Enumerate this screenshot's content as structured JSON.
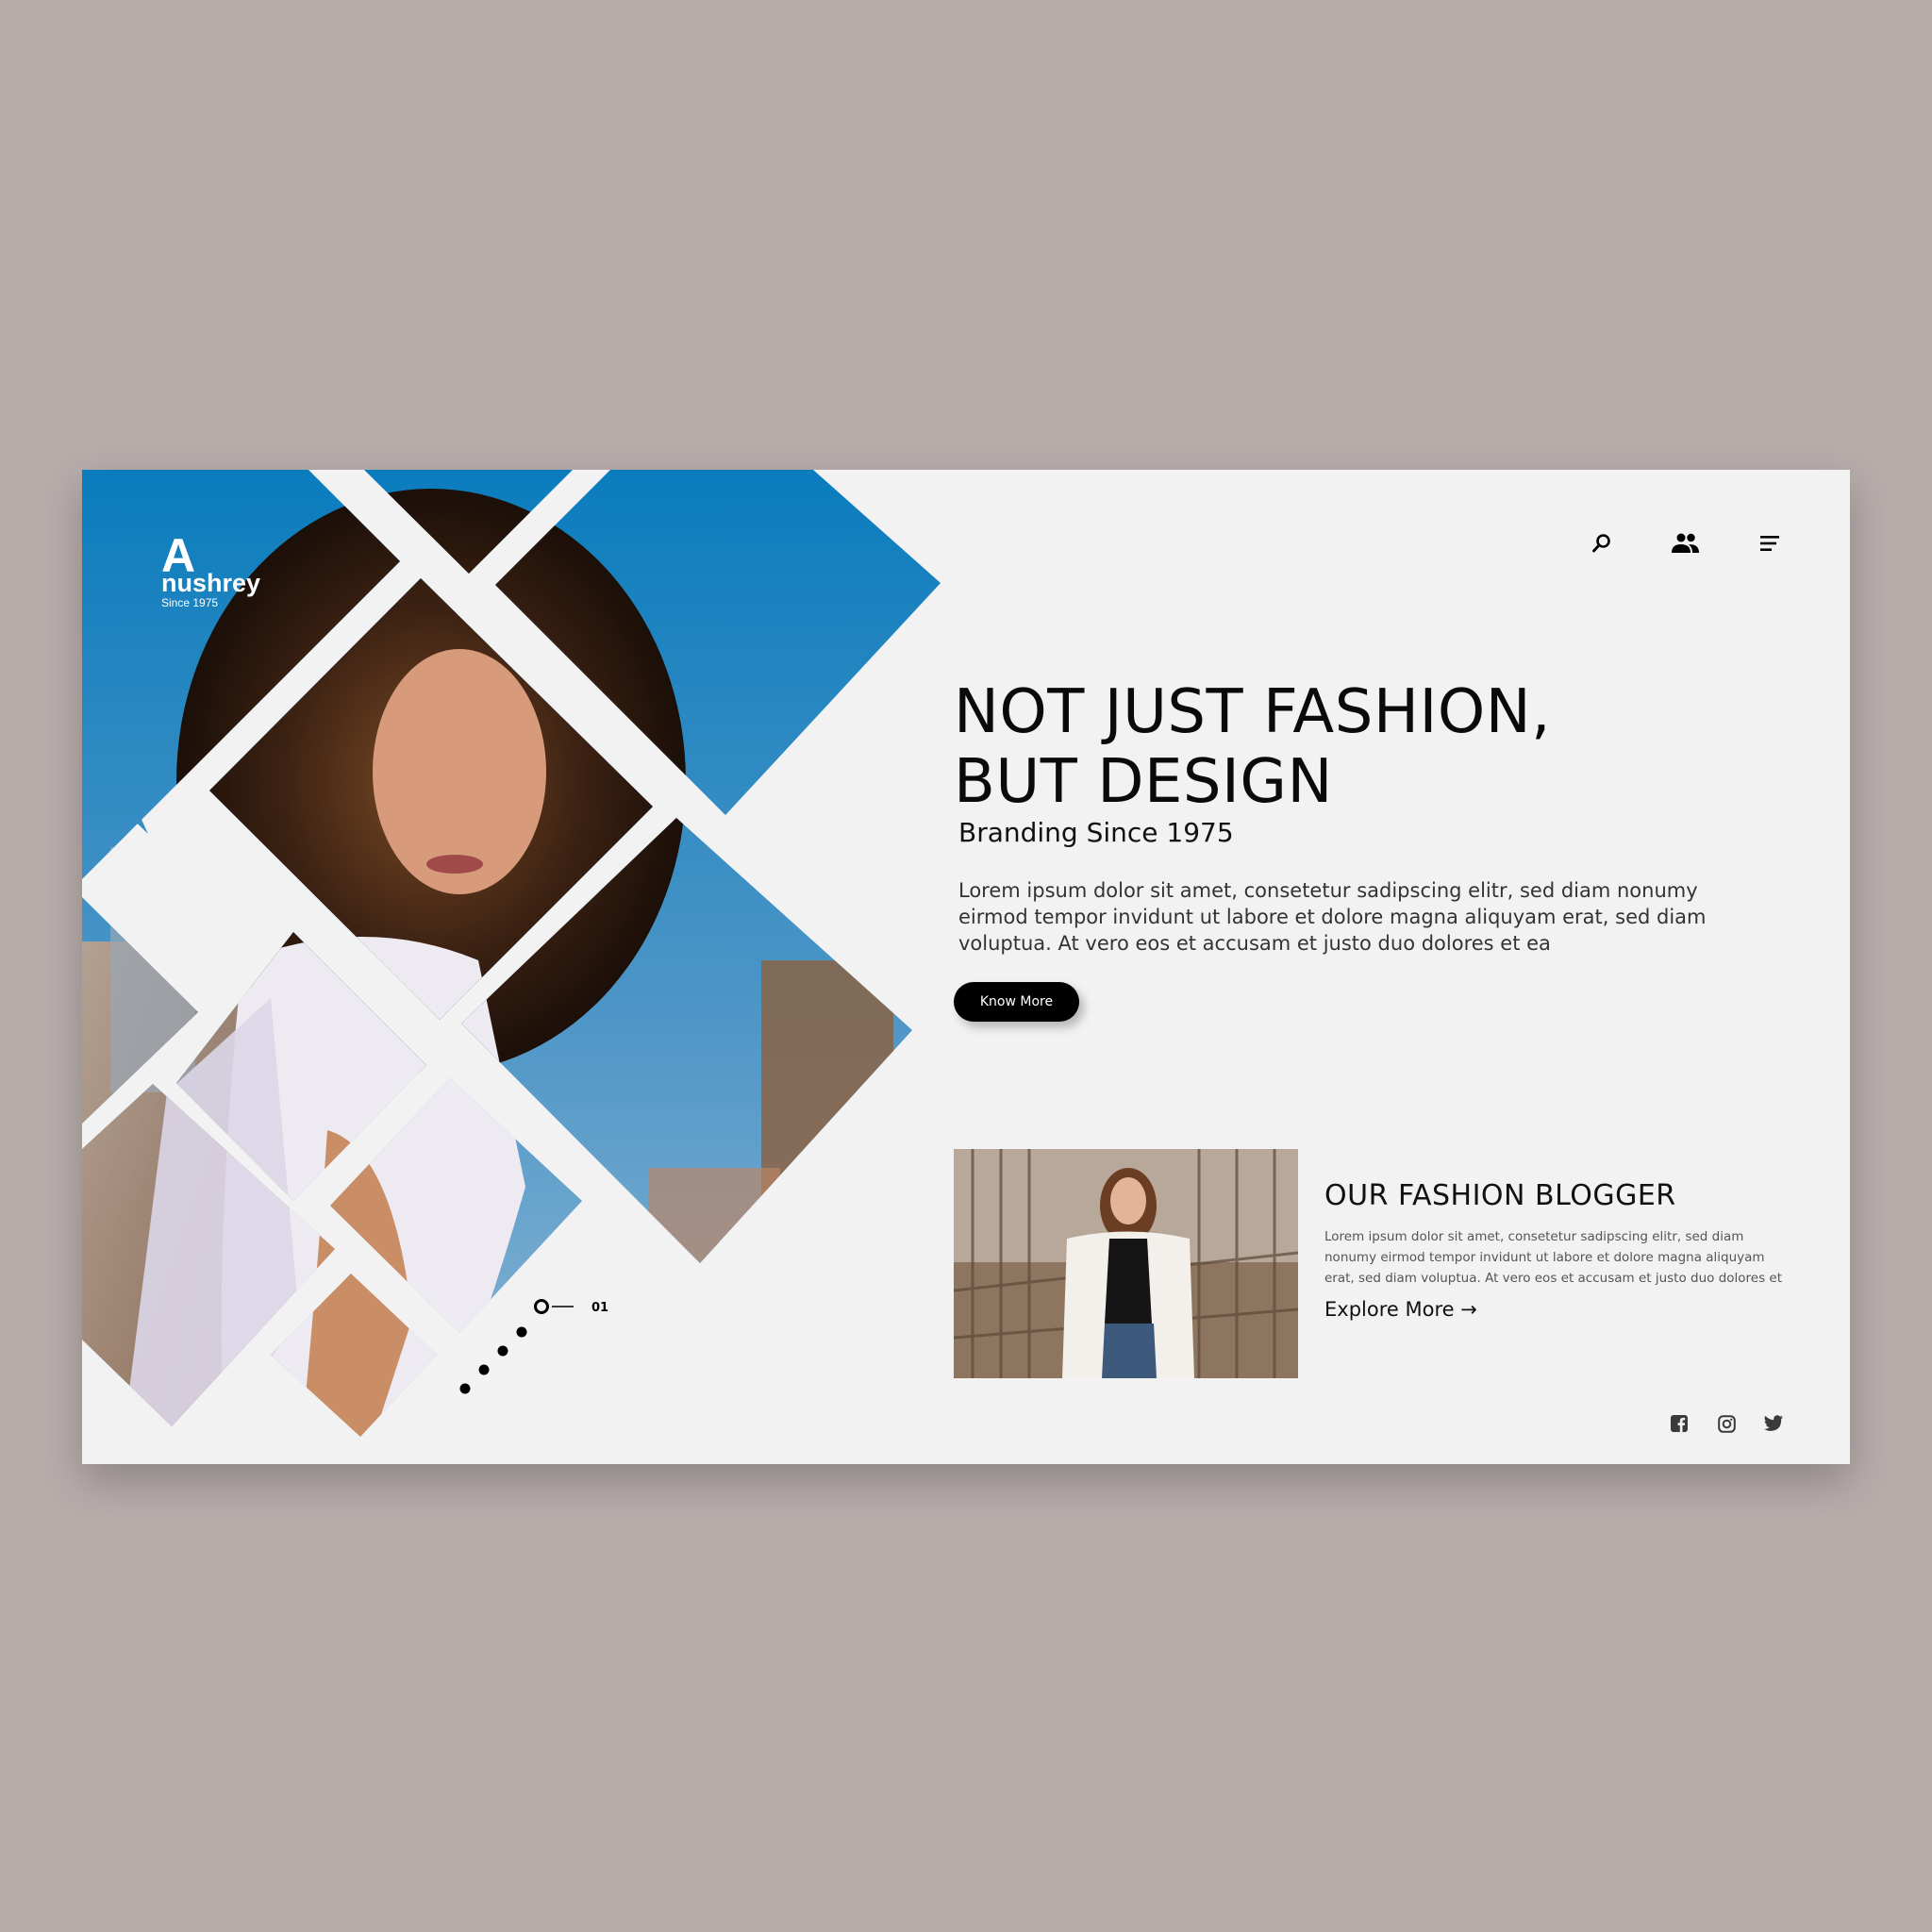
{
  "brand": {
    "logo_letter": "A",
    "name": "nushrey",
    "since": "Since 1975"
  },
  "nav": {
    "icons": [
      "search-icon",
      "users-icon",
      "menu-icon"
    ]
  },
  "hero": {
    "title_line1": "NOT JUST FASHION,",
    "title_line2": "BUT DESIGN",
    "subtitle": "Branding Since 1975",
    "body": "Lorem ipsum dolor sit amet, consetetur sadipscing elitr, sed diam nonumy eirmod tempor invidunt ut labore et dolore magna aliquyam erat, sed diam voluptua. At vero eos et accusam et justo duo dolores et ea",
    "cta_label": "Know More"
  },
  "blogger": {
    "title": "OUR FASHION BLOGGER",
    "body": "Lorem ipsum dolor sit amet, consetetur sadipscing elitr, sed diam nonumy eirmod tempor invidunt ut labore et dolore magna aliquyam erat, sed diam voluptua. At vero eos et accusam et justo duo dolores et",
    "link_label": "Explore More →"
  },
  "slider": {
    "current": "01"
  },
  "socials": [
    "facebook-icon",
    "instagram-icon",
    "twitter-icon"
  ],
  "colors": {
    "page_bg": "#b6acaa",
    "card_bg": "#f2f2f2",
    "sky_blue": "#1a86c4",
    "text": "#0a0a0a",
    "button": "#000000"
  }
}
